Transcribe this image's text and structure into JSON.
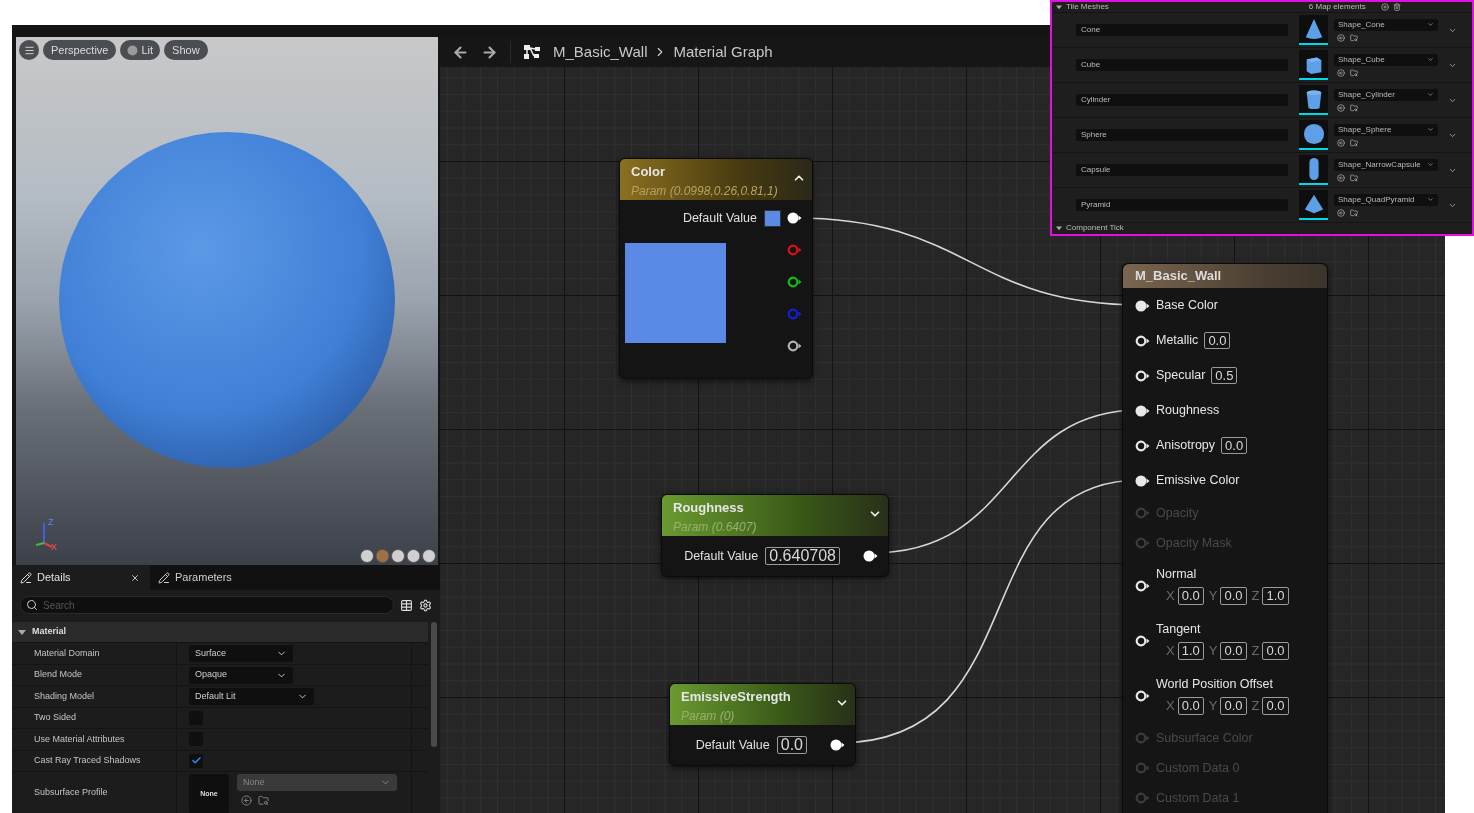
{
  "viewport": {
    "toolbar": [
      {
        "kind": "menu"
      },
      {
        "kind": "button",
        "label": "Perspective"
      },
      {
        "kind": "lighting",
        "label": "Lit"
      },
      {
        "kind": "button",
        "label": "Show"
      }
    ],
    "gizmo": {
      "z": "Z",
      "x": "X"
    }
  },
  "details": {
    "tabs": [
      {
        "label": "Details",
        "selected": true,
        "closable": true
      },
      {
        "label": "Parameters",
        "selected": false,
        "closable": false
      }
    ],
    "search": {
      "placeholder": "Search"
    },
    "section": {
      "title": "Material",
      "expanded": true
    },
    "properties": [
      {
        "label": "Material Domain",
        "kind": "dropdown",
        "value": "Surface"
      },
      {
        "label": "Blend Mode",
        "kind": "dropdown",
        "value": "Opaque"
      },
      {
        "label": "Shading Model",
        "kind": "dropdown",
        "value": "Default Lit"
      },
      {
        "label": "Two Sided",
        "kind": "checkbox",
        "checked": false
      },
      {
        "label": "Use Material Attributes",
        "kind": "checkbox",
        "checked": false
      },
      {
        "label": "Cast Ray Traced Shadows",
        "kind": "checkbox",
        "checked": true
      },
      {
        "label": "Subsurface Profile",
        "kind": "asset",
        "thumbnail": "None",
        "value": "None"
      }
    ]
  },
  "graph": {
    "breadcrumb": [
      "M_Basic_Wall",
      "Material Graph"
    ],
    "parameter_nodes": [
      {
        "kind": "vector",
        "title": "Color",
        "subtitle": "Param (0.0998,0.26,0.81,1)",
        "value_label": "Default Value",
        "color": "#5b8ae6",
        "expanded": true,
        "outputs": [
          {
            "color": "#ffffff",
            "connected": true
          },
          {
            "color": "#e01010",
            "connected": false
          },
          {
            "color": "#10c010",
            "connected": false
          },
          {
            "color": "#1020e0",
            "connected": false
          },
          {
            "color": "#b0b0b0",
            "connected": false
          }
        ]
      },
      {
        "kind": "scalar",
        "title": "Roughness",
        "subtitle": "Param (0.6407)",
        "value_label": "Default Value",
        "value": "0.640708",
        "expanded": false,
        "outputs": [
          {
            "color": "#ffffff",
            "connected": true
          }
        ]
      },
      {
        "kind": "scalar",
        "title": "EmissiveStrength",
        "subtitle": "Param (0)",
        "value_label": "Default Value",
        "value": "0.0",
        "expanded": false,
        "outputs": [
          {
            "color": "#ffffff",
            "connected": true
          }
        ]
      }
    ],
    "material_node": {
      "title": "M_Basic_Wall",
      "inputs": [
        {
          "label": "Base Color",
          "kind": "plain",
          "connected": true,
          "enabled": true
        },
        {
          "label": "Metallic",
          "kind": "scalar",
          "value": "0.0",
          "connected": false,
          "enabled": true
        },
        {
          "label": "Specular",
          "kind": "scalar",
          "value": "0.5",
          "connected": false,
          "enabled": true
        },
        {
          "label": "Roughness",
          "kind": "plain",
          "connected": true,
          "enabled": true
        },
        {
          "label": "Anisotropy",
          "kind": "scalar",
          "value": "0.0",
          "connected": false,
          "enabled": true
        },
        {
          "label": "Emissive Color",
          "kind": "plain",
          "connected": true,
          "enabled": true
        },
        {
          "label": "Opacity",
          "kind": "plain",
          "connected": false,
          "enabled": false
        },
        {
          "label": "Opacity Mask",
          "kind": "plain",
          "connected": false,
          "enabled": false
        },
        {
          "label": "Normal",
          "kind": "vector",
          "connected": false,
          "enabled": true,
          "values": [
            {
              "axis": "X",
              "value": "0.0"
            },
            {
              "axis": "Y",
              "value": "0.0"
            },
            {
              "axis": "Z",
              "value": "1.0"
            }
          ]
        },
        {
          "label": "Tangent",
          "kind": "vector",
          "connected": false,
          "enabled": true,
          "values": [
            {
              "axis": "X",
              "value": "1.0"
            },
            {
              "axis": "Y",
              "value": "0.0"
            },
            {
              "axis": "Z",
              "value": "0.0"
            }
          ]
        },
        {
          "label": "World Position Offset",
          "kind": "vector",
          "connected": false,
          "enabled": true,
          "values": [
            {
              "axis": "X",
              "value": "0.0"
            },
            {
              "axis": "Y",
              "value": "0.0"
            },
            {
              "axis": "Z",
              "value": "0.0"
            }
          ]
        },
        {
          "label": "Subsurface Color",
          "kind": "plain",
          "connected": false,
          "enabled": false
        },
        {
          "label": "Custom Data 0",
          "kind": "plain",
          "connected": false,
          "enabled": false
        },
        {
          "label": "Custom Data 1",
          "kind": "plain",
          "connected": false,
          "enabled": false
        }
      ]
    }
  },
  "tile_meshes": {
    "title": "Tile Meshes",
    "count": "6 Map elements",
    "rows": [
      {
        "key": "Cone",
        "asset": "Shape_Cone",
        "kind": "cone"
      },
      {
        "key": "Cube",
        "asset": "Shape_Cube",
        "kind": "cube"
      },
      {
        "key": "Cylinder",
        "asset": "Shape_Cylinder",
        "kind": "cylinder"
      },
      {
        "key": "Sphere",
        "asset": "Shape_Sphere",
        "kind": "sphere"
      },
      {
        "key": "Capsule",
        "asset": "Shape_NarrowCapsule",
        "kind": "capsule"
      },
      {
        "key": "Pyramid",
        "asset": "Shape_QuadPyramid",
        "kind": "pyramid"
      }
    ],
    "footer": "Component Tick"
  }
}
